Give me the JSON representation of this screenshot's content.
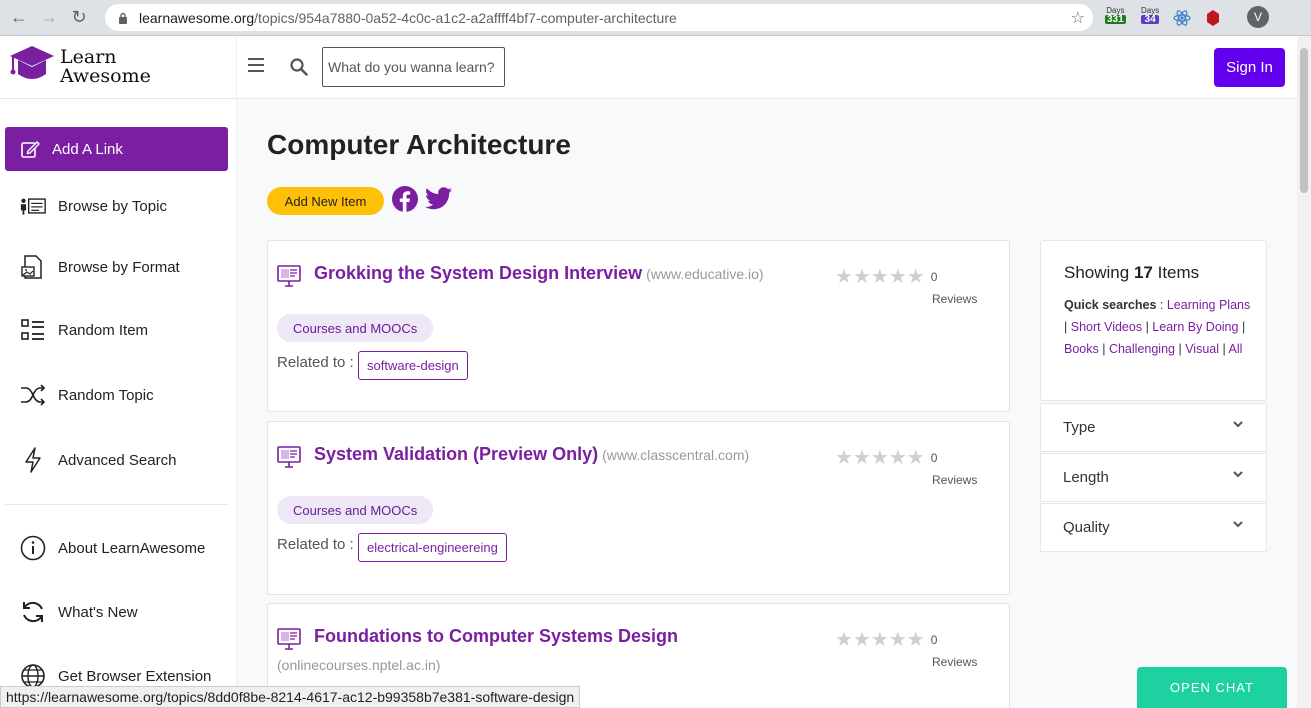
{
  "browser": {
    "url_host": "learnawesome.org",
    "url_path": "/topics/954a7880-0a52-4c0c-a1c2-a2affff4bf7-computer-architecture",
    "ext1_label": "Days",
    "ext1_value": "331",
    "ext2_label": "Days",
    "ext2_value": "34",
    "profile_initial": "V",
    "status_url": "https://learnawesome.org/topics/8dd0f8be-8214-4617-ac12-b99358b7e381-software-design"
  },
  "header": {
    "logo_line1": "Learn",
    "logo_line2": "Awesome",
    "search_placeholder": "What do you wanna learn?",
    "signin_label": "Sign In"
  },
  "sidebar": {
    "add_link_label": "Add A Link",
    "items": [
      {
        "label": "Browse by Topic"
      },
      {
        "label": "Browse by Format"
      },
      {
        "label": "Random Item"
      },
      {
        "label": "Random Topic"
      },
      {
        "label": "Advanced Search"
      },
      {
        "label": "About LearnAwesome"
      },
      {
        "label": "What's New"
      },
      {
        "label": "Get Browser Extension"
      }
    ]
  },
  "main": {
    "title": "Computer Architecture",
    "add_item_label": "Add New Item",
    "cards": [
      {
        "title": "Grokking the System Design Interview",
        "domain": "(www.educative.io)",
        "rating_count": "0",
        "reviews_label": "Reviews",
        "format": "Courses and MOOCs",
        "related_label": "Related to :",
        "tag": "software-design"
      },
      {
        "title": "System Validation (Preview Only)",
        "domain": "(www.classcentral.com)",
        "rating_count": "0",
        "reviews_label": "Reviews",
        "format": "Courses and MOOCs",
        "related_label": "Related to :",
        "tag": "electrical-engineereing"
      },
      {
        "title": "Foundations to Computer Systems Design",
        "domain": "(onlinecourses.nptel.ac.in)",
        "rating_count": "0",
        "reviews_label": "Reviews"
      }
    ]
  },
  "panel": {
    "showing_prefix": "Showing",
    "showing_count": "17",
    "showing_suffix": "Items",
    "quick_label": "Quick searches",
    "quick_links": [
      "Learning Plans",
      "Short Videos",
      "Learn By Doing",
      "Books",
      "Challenging",
      "Visual",
      "All"
    ],
    "facets": [
      "Type",
      "Length",
      "Quality"
    ]
  },
  "chat": {
    "label": "OPEN CHAT"
  }
}
